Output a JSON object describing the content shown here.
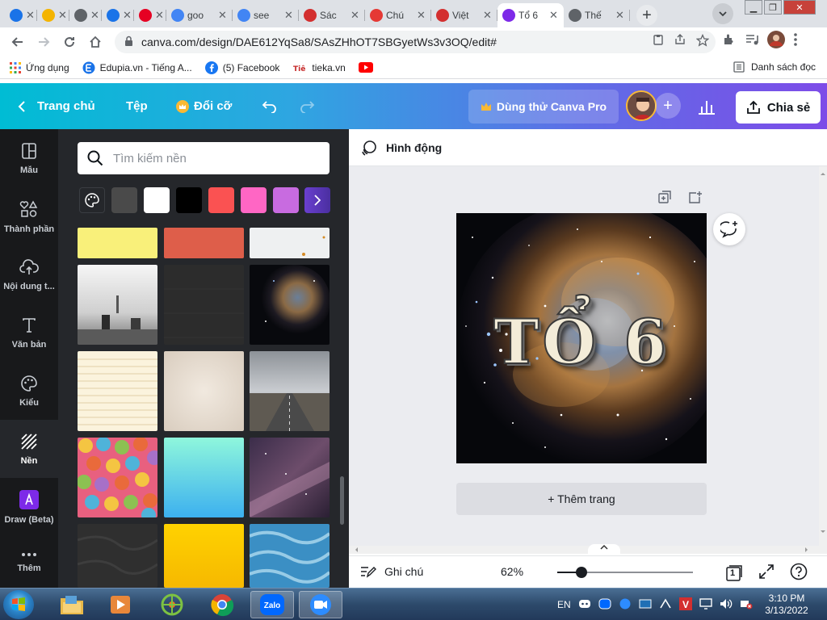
{
  "browser": {
    "tabs": [
      {
        "label": "",
        "color": "#1a73e8"
      },
      {
        "label": "",
        "color": "#f4b400"
      },
      {
        "label": "",
        "color": "#5f6368"
      },
      {
        "label": "",
        "color": "#1a73e8"
      },
      {
        "label": "",
        "color": "#e60023"
      },
      {
        "label": "goo",
        "color": "#4285f4"
      },
      {
        "label": "see",
        "color": "#4285f4"
      },
      {
        "label": "Sác",
        "color": "#d32f2f"
      },
      {
        "label": "Chú",
        "color": "#e53935"
      },
      {
        "label": "Việt",
        "color": "#d32f2f"
      },
      {
        "label": "Tổ 6",
        "color": "#7d2ae8"
      },
      {
        "label": "Thế",
        "color": "#5f6368"
      }
    ],
    "active_tab": 10,
    "url": "canva.com/design/DAE612YqSa8/SAsZHhOT7SBGyetWs3v3OQ/edit#",
    "bookmarks": [
      {
        "label": "Ứng dụng"
      },
      {
        "label": "Edupia.vn - Tiếng A..."
      },
      {
        "label": "(5) Facebook"
      },
      {
        "label": "tieka.vn"
      },
      {
        "label": ""
      }
    ],
    "reading_list": "Danh sách đọc"
  },
  "canva": {
    "header": {
      "home": "Trang chủ",
      "file": "Tệp",
      "resize": "Đổi cỡ",
      "try_pro": "Dùng thử Canva Pro",
      "share": "Chia sẻ"
    },
    "rail": [
      {
        "label": "Mẫu",
        "icon": "template-icon"
      },
      {
        "label": "Thành phần",
        "icon": "elements-icon"
      },
      {
        "label": "Nội dung t...",
        "icon": "upload-icon"
      },
      {
        "label": "Văn bản",
        "icon": "text-icon"
      },
      {
        "label": "Kiểu",
        "icon": "palette-icon"
      },
      {
        "label": "Nền",
        "icon": "background-icon"
      },
      {
        "label": "Draw (Beta)",
        "icon": "draw-icon"
      },
      {
        "label": "Thêm",
        "icon": "more-icon"
      }
    ],
    "active_rail": 5,
    "search_placeholder": "Tìm kiếm nền",
    "swatches": [
      "#4a4a4a",
      "#ffffff",
      "#000000",
      "#fa5252",
      "#ff66c4",
      "#c86be0"
    ],
    "animation": "Hình động",
    "design_title": "TỔ 6",
    "add_page": "+ Thêm trang",
    "notes": "Ghi chú",
    "zoom": {
      "label": "62%",
      "value": 62,
      "min": 10,
      "max": 500
    },
    "page_count": "1"
  },
  "taskbar": {
    "lang": "EN",
    "time": "3:10 PM",
    "date": "3/13/2022"
  }
}
